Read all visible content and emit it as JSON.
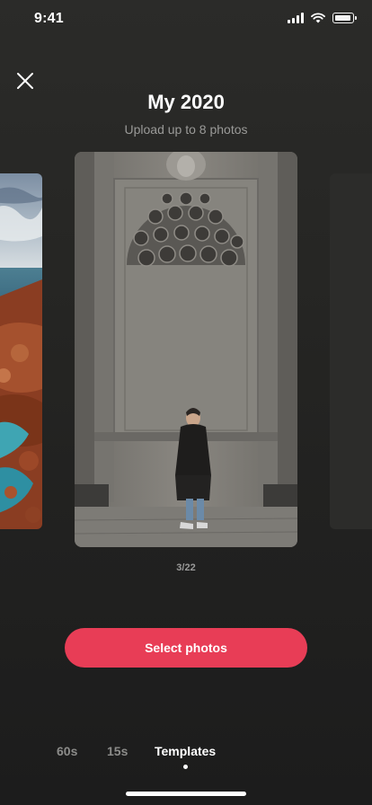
{
  "status_bar": {
    "time": "9:41",
    "icons": [
      "cellular-signal-icon",
      "wifi-icon",
      "battery-icon"
    ]
  },
  "header": {
    "title": "My 2020",
    "subtitle": "Upload up to 8 photos",
    "close_icon": "close-icon"
  },
  "carousel": {
    "counter": "3/22",
    "current_index": 3,
    "total": 22
  },
  "actions": {
    "select_label": "Select photos",
    "select_color": "#e83d56"
  },
  "tabs": [
    {
      "label": "60s",
      "active": false
    },
    {
      "label": "15s",
      "active": false
    },
    {
      "label": "Templates",
      "active": true
    }
  ]
}
